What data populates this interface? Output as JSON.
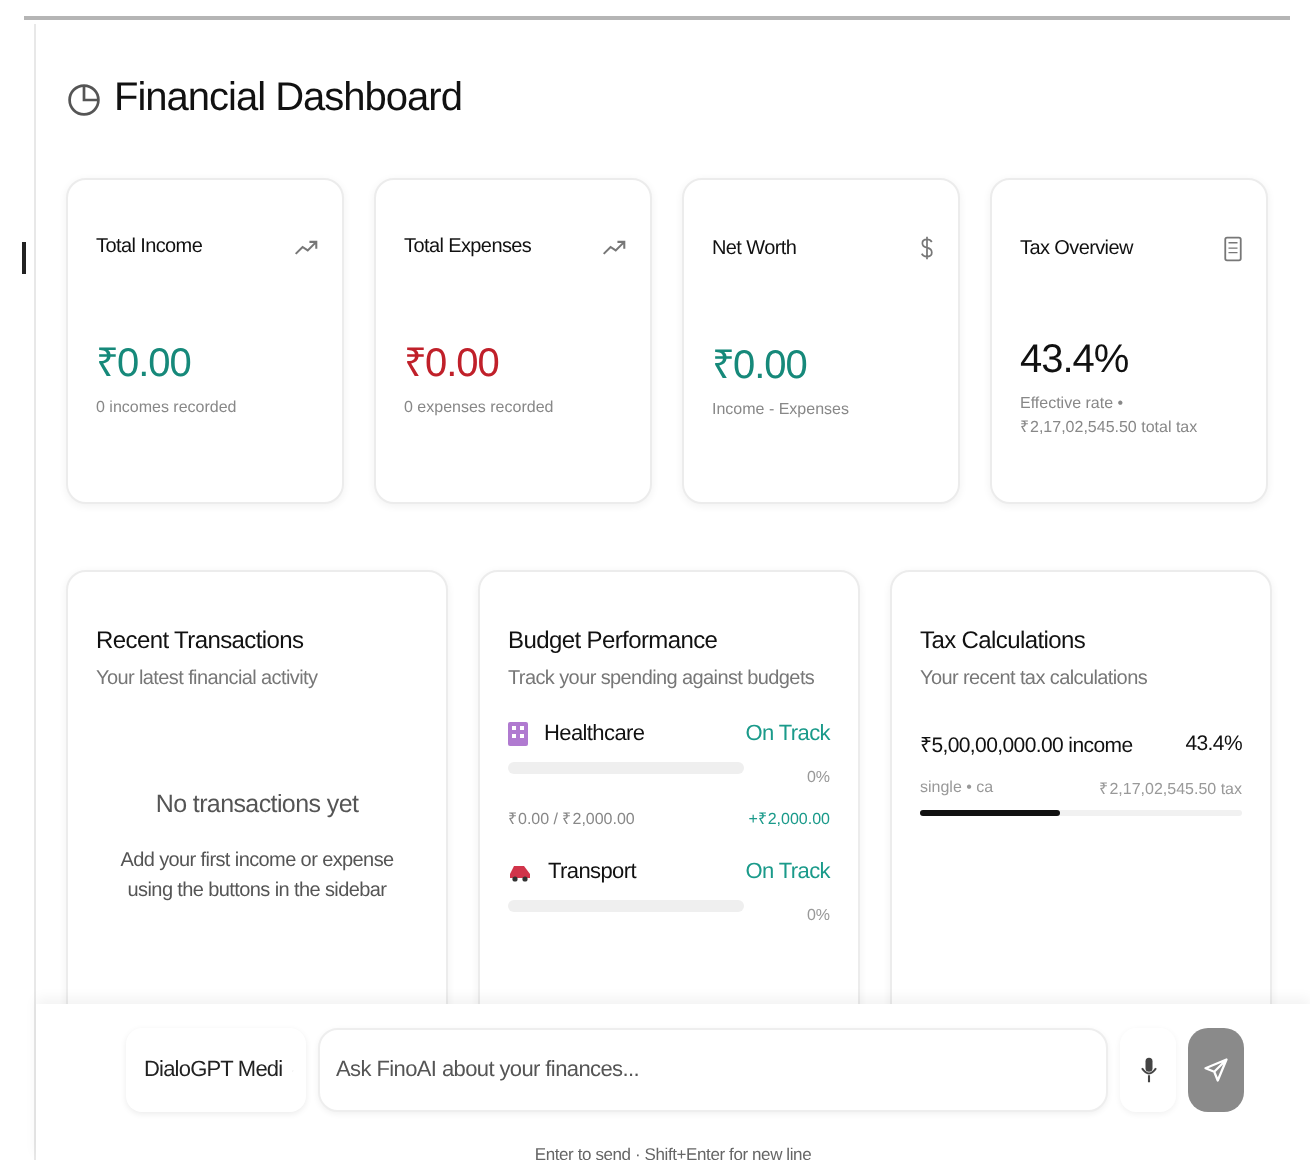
{
  "title": "Financial Dashboard",
  "stats": [
    {
      "kind": "trend",
      "label": "Total Income",
      "value": "₹0.00",
      "color": "#16897a",
      "note": "0 incomes recorded"
    },
    {
      "kind": "trend",
      "label": "Total Expenses",
      "value": "₹0.00",
      "color": "#c0202a",
      "note": "0 expenses recorded"
    },
    {
      "kind": "dollar",
      "label": "Net Worth",
      "value": "₹0.00",
      "color": "#16897a",
      "note": "Income - Expenses"
    },
    {
      "kind": "calculator",
      "label": "Tax Overview",
      "value": "43.4%",
      "color": "#111111",
      "note": "Effective rate • ₹2,17,02,545.50 total tax"
    }
  ],
  "transactions": {
    "title": "Recent Transactions",
    "subtitle": "Your latest financial activity",
    "empty_title": "No transactions yet",
    "empty_text": "Add your first income or expense using the buttons in the sidebar"
  },
  "budget": {
    "title": "Budget Performance",
    "subtitle": "Track your spending against budgets",
    "items": [
      {
        "kind": "hospital",
        "name": "Healthcare",
        "status": "On Track",
        "level": 0,
        "percent": "0%",
        "spent": "₹0.00 / ₹2,000.00",
        "remaining": "+₹2,000.00"
      },
      {
        "kind": "car",
        "name": "Transport",
        "status": "On Track",
        "level": 0,
        "percent": "0%"
      }
    ]
  },
  "tax": {
    "title": "Tax Calculations",
    "subtitle": "Your recent tax calculations",
    "items": [
      {
        "income": "₹5,00,00,000.00 income",
        "rate": "43.4%",
        "meta": "single • ca",
        "tax": "₹2,17,02,545.50 tax",
        "level": 0.434
      }
    ]
  },
  "composer": {
    "model": "DialoGPT Medi",
    "placeholder": "Ask FinoAI about your finances...",
    "hint": "Enter to send · Shift+Enter for new line"
  }
}
